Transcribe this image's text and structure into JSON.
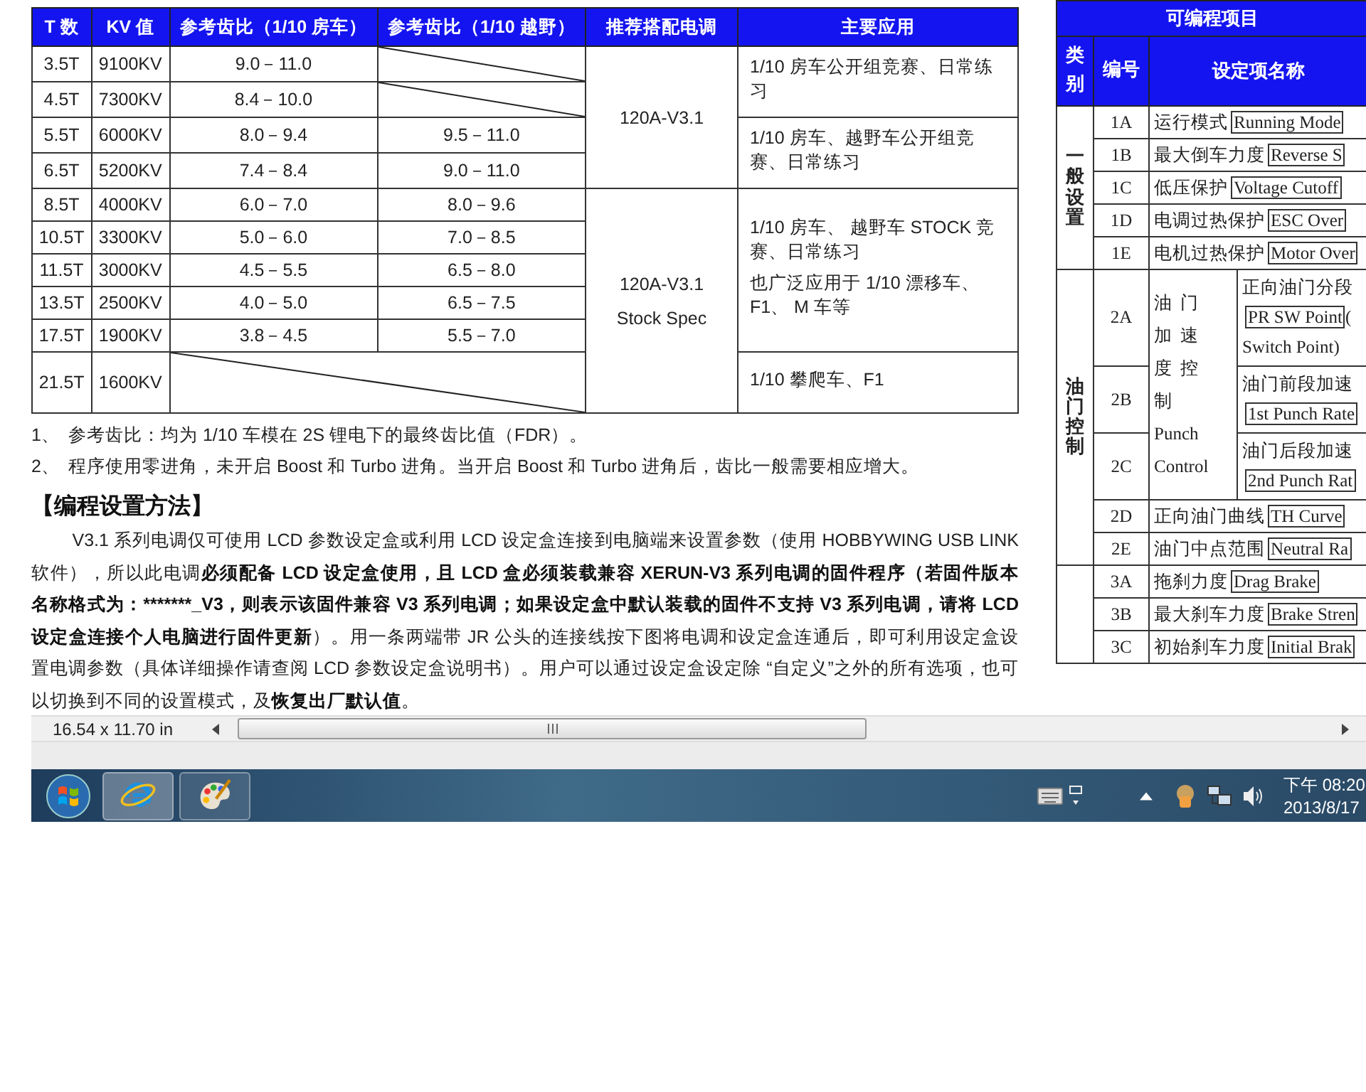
{
  "ratio_table": {
    "columns": [
      "T 数",
      "KV 值",
      "参考齿比（1/10 房车）",
      "参考齿比（1/10  越野）",
      "推荐搭配电调",
      "主要应用"
    ],
    "esc_groups": [
      {
        "esc": [
          "120A-V3.1"
        ],
        "app_groups": [
          {
            "application": [
              "1/10  房车公开组竞赛、日常练习"
            ],
            "rows": [
              {
                "turns": "3.5T",
                "kv": "9100KV",
                "touring": "9.0－11.0"
              },
              {
                "turns": "4.5T",
                "kv": "7300KV",
                "touring": "8.4－10.0"
              }
            ]
          },
          {
            "application": [
              "1/10 房车、越野车公开组竞赛、日常练习"
            ],
            "rows": [
              {
                "turns": "5.5T",
                "kv": "6000KV",
                "touring": "8.0－9.4",
                "offroad": "9.5－11.0"
              },
              {
                "turns": "6.5T",
                "kv": "5200KV",
                "touring": "7.4－8.4",
                "offroad": "9.0－11.0"
              }
            ]
          }
        ]
      },
      {
        "esc": [
          "120A-V3.1",
          "Stock Spec"
        ],
        "app_groups": [
          {
            "application": [
              "1/10 房车、 越野车 STOCK 竞赛、日常练习",
              "也广泛应用于  1/10  漂移车、F1、  M 车等"
            ],
            "rows": [
              {
                "turns": "8.5T",
                "kv": "4000KV",
                "touring": "6.0－7.0",
                "offroad": "8.0－9.6"
              },
              {
                "turns": "10.5T",
                "kv": "3300KV",
                "touring": "5.0－6.0",
                "offroad": "7.0－8.5"
              },
              {
                "turns": "11.5T",
                "kv": "3000KV",
                "touring": "4.5－5.5",
                "offroad": "6.5－8.0"
              },
              {
                "turns": "13.5T",
                "kv": "2500KV",
                "touring": "4.0－5.0",
                "offroad": "6.5－7.5"
              },
              {
                "turns": "17.5T",
                "kv": "1900KV",
                "touring": "3.8－4.5",
                "offroad": "5.5－7.0"
              }
            ]
          },
          {
            "application": [
              "1/10  攀爬车、F1"
            ],
            "rows": [
              {
                "turns": "21.5T",
                "kv": "1600KV"
              }
            ]
          }
        ]
      }
    ]
  },
  "notes": [
    {
      "number": "1、",
      "text": "参考齿比：均为 1/10 车模在 2S 锂电下的最终齿比值（FDR）。"
    },
    {
      "number": "2、",
      "text": "程序使用零进角，未开启 Boost  和 Turbo  进角。当开启 Boost  和 Turbo  进角后，齿比一般需要相应增大。"
    }
  ],
  "section_heading": "【编程设置方法】",
  "paragraph": [
    {
      "text": "V3.1 系列电调仅可使用 LCD 参数设定盒或利用 LCD 设定盒连接到电脑端来设置参数（使用 HOBBYWING USB LINK 软件），所以此电调",
      "bold": false
    },
    {
      "text": "必须配备 LCD  设定盒使用，且 LCD  盒必须装载兼容 XERUN-V3 系列电调的固件程序（若固件版本名称格式为：*******_V3，则表示该固件兼容 V3 系列电调；如果设定盒中默认装载的固件不支持 V3 系列电调，请将 LCD  设定盒连接个人电脑进行固件更新",
      "bold": true
    },
    {
      "text": "）。用一条两端带 JR  公头的连接线按下图将电调和设定盒连通后，即可利用设定盒设置电调参数（具体详细操作请查阅 LCD  参数设定盒说明书）。用户可以通过设定盒设定除 “自定义”之外的所有选项，也可以切换到不同的设置模式，及",
      "bold": false
    },
    {
      "text": "恢复出厂默认值",
      "bold": true
    },
    {
      "text": "。",
      "bold": false
    }
  ],
  "settings_table": {
    "title": "可编程项目",
    "columns": [
      "类别",
      "编号",
      "设定项名称"
    ],
    "categories": [
      {
        "label": "一般设置",
        "items": [
          {
            "kind": "item",
            "code": "1A",
            "name": "运行模式",
            "english": "Running Mode"
          },
          {
            "kind": "item",
            "code": "1B",
            "name": "最大倒车力度",
            "english": "Reverse S"
          },
          {
            "kind": "item",
            "code": "1C",
            "name": "低压保护",
            "english": "Voltage Cutoff"
          },
          {
            "kind": "item",
            "code": "1D",
            "name": "电调过热保护",
            "english": "ESC Over"
          },
          {
            "kind": "item",
            "code": "1E",
            "name": "电机过热保护",
            "english": "Motor Over"
          }
        ]
      },
      {
        "label": "油门控制",
        "items": [
          {
            "kind": "group",
            "label": [
              "油门加速度控制",
              "Punch Control"
            ],
            "items": [
              {
                "code": "2A",
                "name": "正向油门分段",
                "english": "PR SW Point",
                "after": "(",
                "continuation": "Switch Point)"
              },
              {
                "code": "2B",
                "name": "油门前段加速",
                "english": "1st Punch Rate"
              },
              {
                "code": "2C",
                "name": "油门后段加速",
                "english": "2nd Punch Rat"
              }
            ]
          },
          {
            "kind": "item",
            "code": "2D",
            "name": "正向油门曲线",
            "english": "TH Curve"
          },
          {
            "kind": "item",
            "code": "2E",
            "name": "油门中点范围",
            "english": "Neutral Ra"
          }
        ]
      },
      {
        "items": [
          {
            "kind": "item",
            "code": "3A",
            "name": "拖刹力度",
            "english": "Drag Brake"
          },
          {
            "kind": "item",
            "code": "3B",
            "name": "最大刹车力度",
            "english": "Brake Stren"
          },
          {
            "kind": "item",
            "code": "3C",
            "name": "初始刹车力度",
            "english": "Initial Brak"
          }
        ]
      }
    ]
  },
  "status_bar": {
    "page_size": "16.54 x 11.70 in"
  },
  "taskbar": {
    "clock_time": "下午 08:20",
    "clock_date": "2013/8/17"
  }
}
